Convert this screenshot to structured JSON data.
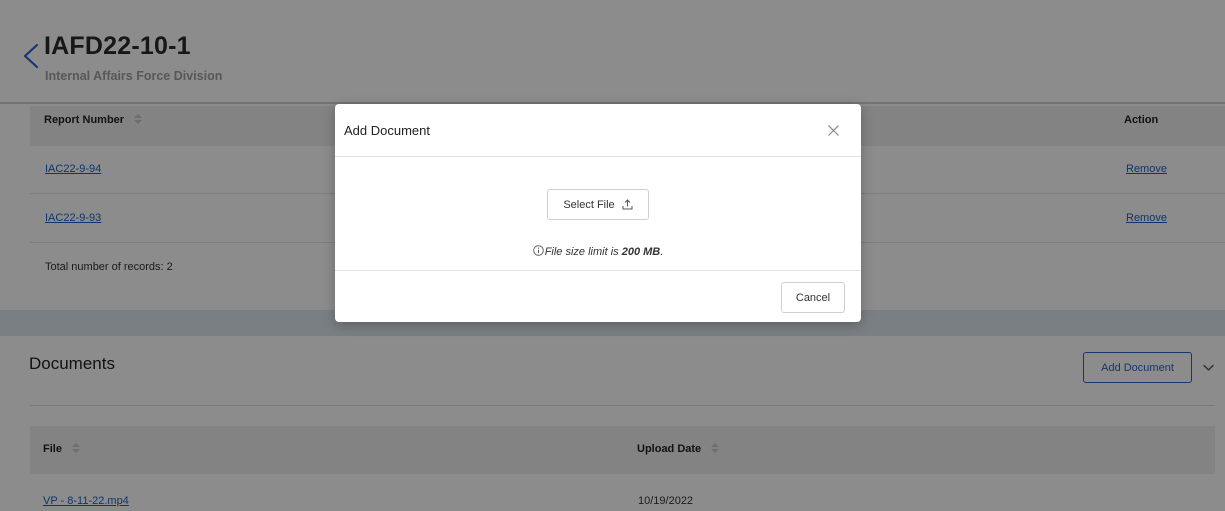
{
  "header": {
    "title": "IAFD22-10-1",
    "subtitle": "Internal Affairs Force Division"
  },
  "reports": {
    "columns": {
      "report_number": "Report Number",
      "action": "Action"
    },
    "rows": [
      {
        "report_number": "IAC22-9-94",
        "action": "Remove"
      },
      {
        "report_number": "IAC22-9-93",
        "action": "Remove"
      }
    ],
    "total": "Total number of records: 2"
  },
  "documents": {
    "title": "Documents",
    "add_button": "Add Document",
    "columns": {
      "file": "File",
      "upload_date": "Upload Date"
    },
    "rows": [
      {
        "file": "VP - 8-11-22.mp4",
        "upload_date": "10/19/2022"
      }
    ]
  },
  "modal": {
    "title": "Add Document",
    "select_file": "Select File",
    "size_note_prefix": "File size limit is ",
    "size_limit": "200 MB",
    "size_note_suffix": ".",
    "cancel": "Cancel"
  },
  "icons": {
    "back": "chevron-left-icon",
    "sort": "sort-icon",
    "collapse": "chevron-down-icon",
    "close": "close-icon",
    "upload": "upload-icon",
    "info": "info-icon"
  },
  "colors": {
    "link": "#1f5fc9",
    "accent": "#2c63c9",
    "overlay": "rgba(0,0,0,0.45)"
  }
}
